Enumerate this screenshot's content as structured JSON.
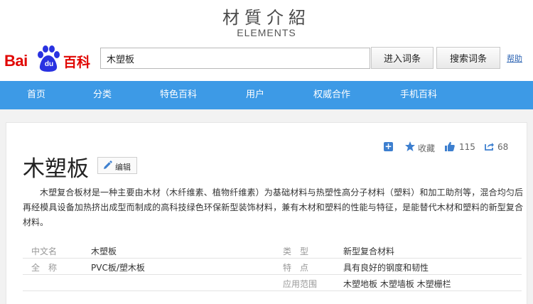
{
  "banner": {
    "title": "材質介紹",
    "subtitle": "ELEMENTS"
  },
  "logo": {
    "bai": "Bai",
    "du": "du",
    "baike": "百科"
  },
  "search": {
    "value": "木塑板",
    "enter_label": "进入词条",
    "search_label": "搜索词条",
    "help_label": "帮助"
  },
  "nav": {
    "items": [
      "首页",
      "分类",
      "特色百科",
      "用户",
      "权威合作",
      "手机百科"
    ]
  },
  "actions": {
    "favorite_label": "收藏",
    "like_count": "115",
    "share_count": "68"
  },
  "article": {
    "title": "木塑板",
    "edit_label": "编辑",
    "summary": "木塑复合板材是一种主要由木材（木纤维素、植物纤维素）为基础材料与热塑性高分子材料（塑料）和加工助剂等，混合均匀后再经模具设备加热挤出成型而制成的高科技绿色环保新型装饰材料，兼有木材和塑料的性能与特征，是能替代木材和塑料的新型复合材料。"
  },
  "info": {
    "rows": [
      {
        "l1": "中文名",
        "v1": "木塑板",
        "l2": "类　型",
        "v2": "新型复合材料"
      },
      {
        "l1": "全　称",
        "v1": "PVC板/塑木板",
        "l2": "特　点",
        "v2": "具有良好的钢度和韧性"
      },
      {
        "l1": "",
        "v1": "",
        "l2": "应用范围",
        "v2": "木塑地板 木塑墙板 木塑栅栏"
      }
    ]
  },
  "colors": {
    "nav_blue": "#3d9ae6",
    "baidu_red": "#e10602",
    "baidu_blue": "#2932e1",
    "link_blue": "#2d64b3"
  }
}
